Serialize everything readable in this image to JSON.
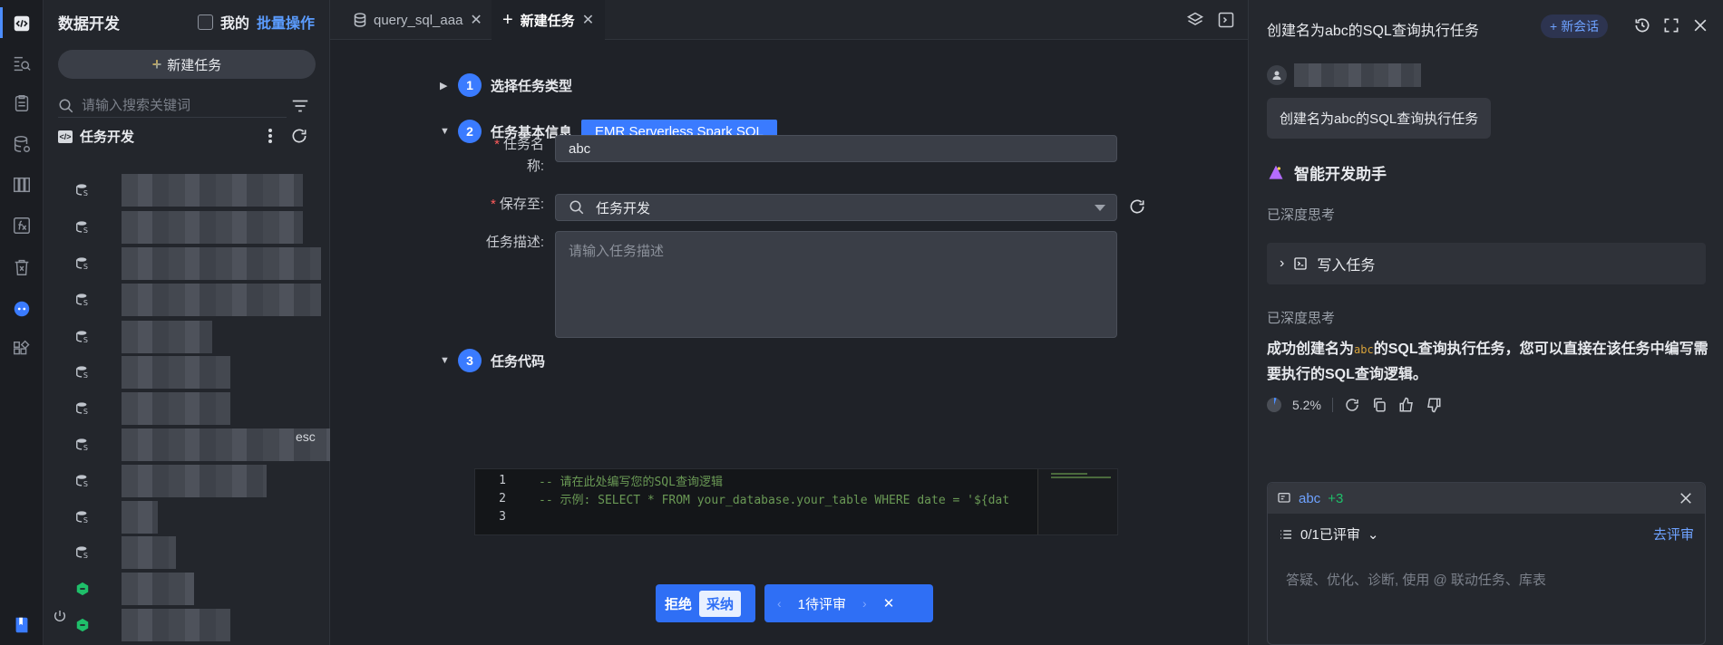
{
  "sidebar": {
    "title": "数据开发",
    "mine_label": "我的",
    "batch_label": "批量操作",
    "new_task_label": "新建任务",
    "search_placeholder": "请输入搜索关键词",
    "tree_root_label": "任务开发",
    "clipped_text": "esc"
  },
  "tabs": [
    {
      "label": "query_sql_aaa"
    },
    {
      "label": "新建任务"
    }
  ],
  "form": {
    "step1": {
      "num": "1",
      "label": "选择任务类型"
    },
    "step2": {
      "num": "2",
      "label": "任务基本信息",
      "type_tag": "EMR Serverless Spark SQL"
    },
    "step3": {
      "num": "3",
      "label": "任务代码"
    },
    "name_label_1": "任务名",
    "name_label_2": "称:",
    "name_value": "abc",
    "save_label": "保存至:",
    "save_value": "任务开发",
    "desc_label": "任务描述:",
    "desc_placeholder": "请输入任务描述"
  },
  "code": {
    "lines": [
      {
        "n": "1",
        "text": "-- 请在此处编写您的SQL查询逻辑"
      },
      {
        "n": "2",
        "text": "-- 示例: SELECT * FROM your_database.your_table WHERE date = '${dat"
      },
      {
        "n": "3",
        "text": ""
      }
    ]
  },
  "review": {
    "reject": "拒绝",
    "accept": "采纳",
    "pending": "1待评审"
  },
  "ai": {
    "title": "创建名为abc的SQL查询执行任务",
    "new_chat": "新会话",
    "user_message": "创建名为abc的SQL查询执行任务",
    "assistant_name": "智能开发助手",
    "thought_1": "已深度思考",
    "write_task": "写入任务",
    "thought_2": "已深度思考",
    "answer_part1": "成功创建名为",
    "answer_code": "abc",
    "answer_part2": "的SQL查询执行任务，您可以直接在该任务中编写需要执行的SQL查询逻辑。",
    "percent": "5.2%",
    "ctx_name": "abc",
    "ctx_more": "+3",
    "review_status": "0/1已评审",
    "go_review": "去评审",
    "input_placeholder": "答疑、优化、诊断, 使用 @ 联动任务、库表"
  }
}
